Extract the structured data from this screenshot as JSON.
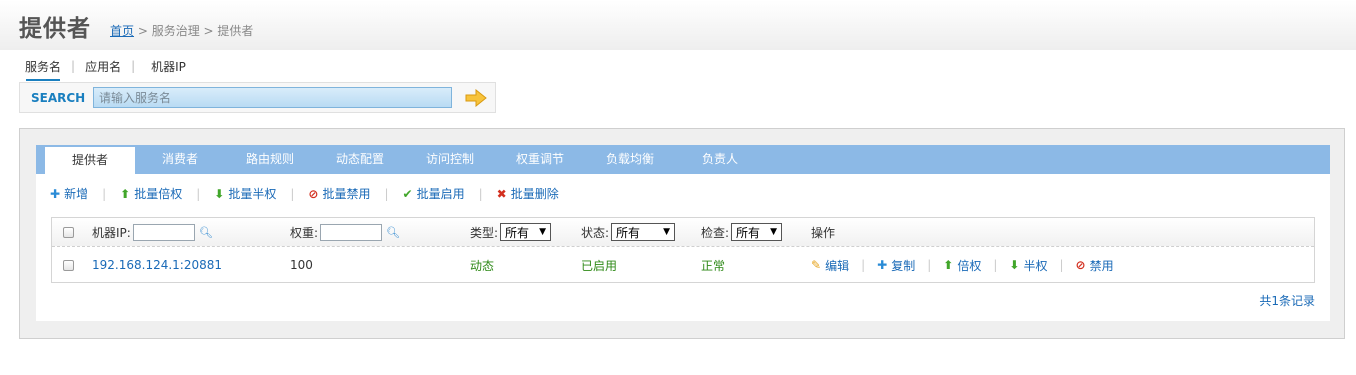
{
  "header": {
    "title": "提供者",
    "breadcrumb": {
      "home": "首页",
      "sep1": " > ",
      "level2": "服务治理",
      "sep2": " > ",
      "current": "提供者"
    }
  },
  "search": {
    "tabs": [
      "服务名",
      "应用名",
      "机器IP"
    ],
    "active_tab": 0,
    "label": "SEARCH",
    "placeholder": "请输入服务名",
    "value": ""
  },
  "tabbar": {
    "tabs": [
      "提供者",
      "消费者",
      "路由规则",
      "动态配置",
      "访问控制",
      "权重调节",
      "负载均衡",
      "负责人"
    ],
    "active": 0
  },
  "actions": [
    {
      "label": "新增",
      "icon": "plus-icon"
    },
    {
      "label": "批量倍权",
      "icon": "arrow-up-icon"
    },
    {
      "label": "批量半权",
      "icon": "arrow-down-icon"
    },
    {
      "label": "批量禁用",
      "icon": "forbidden-icon"
    },
    {
      "label": "批量启用",
      "icon": "check-icon"
    },
    {
      "label": "批量删除",
      "icon": "x-icon"
    }
  ],
  "table": {
    "headers": {
      "ip": "机器IP:",
      "weight": "权重:",
      "type": "类型:",
      "type_value": "所有",
      "status": "状态:",
      "status_value": "所有",
      "check": "检查:",
      "check_value": "所有",
      "ops": "操作"
    },
    "rows": [
      {
        "address": "192.168.124.1:20881",
        "weight": "100",
        "type": "动态",
        "status": "已启用",
        "check": "正常",
        "ops": [
          "编辑",
          "复制",
          "倍权",
          "半权",
          "禁用"
        ]
      }
    ]
  },
  "footer": {
    "total": "共1条记录"
  },
  "colors": {
    "tabbar": "#8cb9e6",
    "link": "#1a6ab7",
    "ok": "#2f8a18",
    "accent": "#1a7fbf"
  }
}
